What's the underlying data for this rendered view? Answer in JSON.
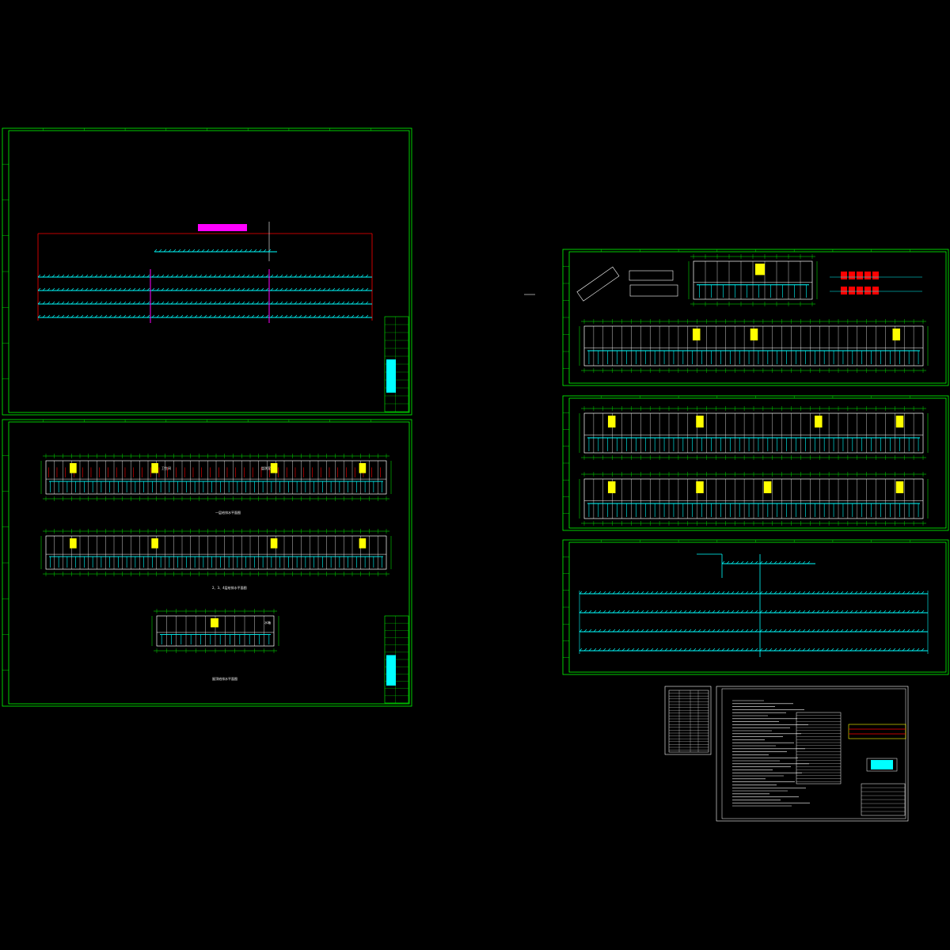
{
  "colors": {
    "background": "#000000",
    "frame": "#00ff00",
    "wall": "#ffffff",
    "pipe_cyan": "#00ffff",
    "pipe_red": "#ff0000",
    "pipe_magenta": "#ff00ff",
    "room_yellow": "#ffff00",
    "pipe_blue": "#3366ff"
  },
  "sheets": [
    {
      "id": "sheet-1",
      "content": "riser-diagram"
    },
    {
      "id": "sheet-2",
      "content": "floor-plans-3"
    },
    {
      "id": "sheet-3",
      "content": "details-and-plan"
    },
    {
      "id": "sheet-4",
      "content": "floor-plans-2"
    },
    {
      "id": "sheet-5",
      "content": "system-diagram"
    },
    {
      "id": "sheet-6",
      "content": "drawing-index"
    },
    {
      "id": "sheet-7",
      "content": "design-notes"
    }
  ],
  "labels": {
    "plan_a": "一层给排水平面图",
    "plan_b": "2、3、4层给排水平面图",
    "plan_c": "屋顶给排水平面图",
    "room_tag": "卫生间",
    "room_tag_2": "盥洗室",
    "room_tag_3": "水箱"
  }
}
